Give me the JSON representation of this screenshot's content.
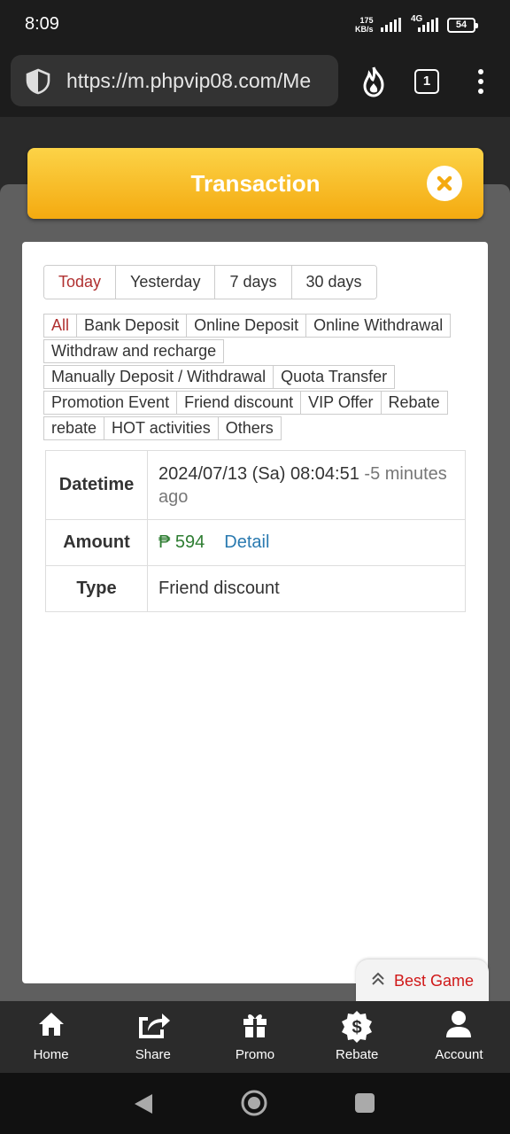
{
  "status_bar": {
    "time": "8:09",
    "speed_value": "175",
    "speed_unit": "KB/s",
    "network": "4G",
    "battery": "54"
  },
  "browser": {
    "url": "https://m.phpvip08.com/Me",
    "tab_count": "1"
  },
  "modal": {
    "title": "Transaction"
  },
  "day_tabs": [
    {
      "label": "Today",
      "active": true
    },
    {
      "label": "Yesterday"
    },
    {
      "label": "7 days"
    },
    {
      "label": "30 days"
    }
  ],
  "categories": [
    "All",
    "Bank Deposit",
    "Online Deposit",
    "Online Withdrawal",
    "Withdraw and recharge",
    "Manually Deposit / Withdrawal",
    "Quota Transfer",
    "Promotion Event",
    "Friend discount",
    "VIP Offer",
    "Rebate",
    "rebate",
    "HOT activities",
    "Others"
  ],
  "record": {
    "datetime_label": "Datetime",
    "datetime_value": "2024/07/13 (Sa) 08:04:51",
    "relative_time": " -5 minutes ago",
    "amount_label": "Amount",
    "amount_value": "₱ 594",
    "detail_link": "Detail",
    "type_label": "Type",
    "type_value": "Friend discount"
  },
  "best_game": "Best Game",
  "bottom_nav": [
    "Home",
    "Share",
    "Promo",
    "Rebate",
    "Account"
  ],
  "colors": {
    "header_gold": "#f4aa10",
    "active_red": "#b03030",
    "amount_green": "#2e7d32",
    "link_blue": "#2a7ab0"
  }
}
